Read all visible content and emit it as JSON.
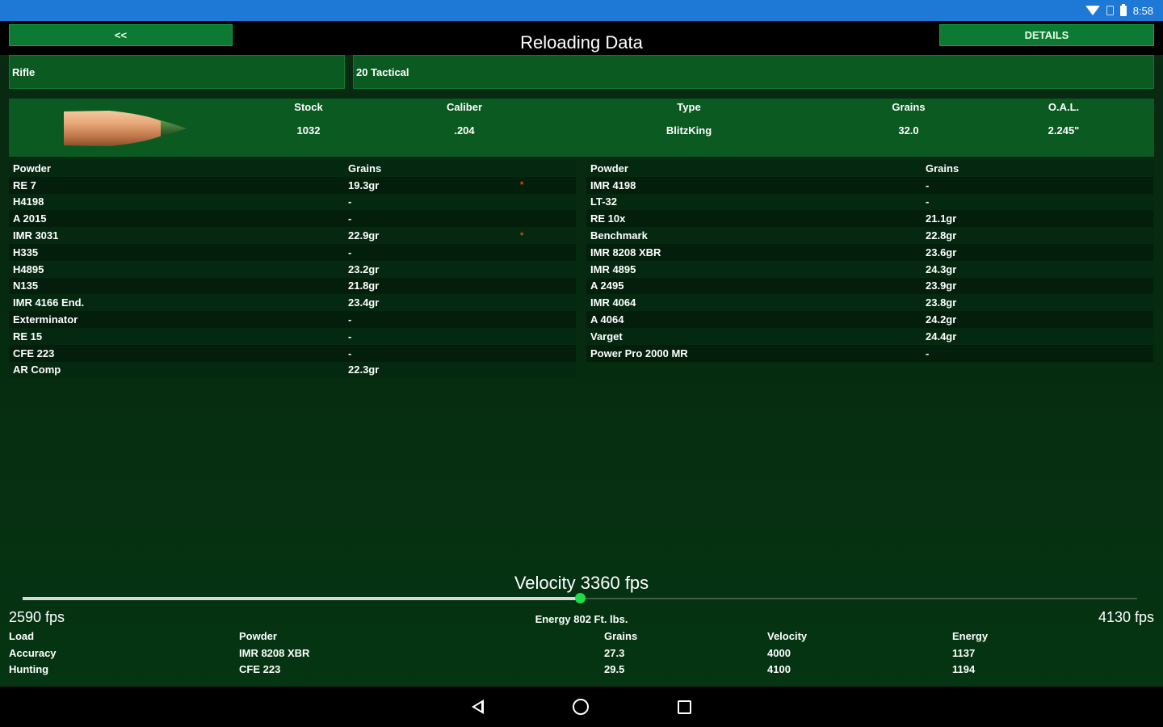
{
  "status_bar": {
    "time": "8:58",
    "icons": [
      "wifi-icon",
      "sim-icon",
      "battery-icon"
    ]
  },
  "header": {
    "back_label": "<<",
    "title": "Reloading Data",
    "details_label": "DETAILS"
  },
  "selectors": {
    "category": "Rifle",
    "caliber": "20 Tactical"
  },
  "bullet": {
    "image": "bullet-image",
    "specs": [
      {
        "label": "Stock",
        "value": "1032"
      },
      {
        "label": "Caliber",
        "value": ".204"
      },
      {
        "label": "Type",
        "value": "BlitzKing"
      },
      {
        "label": "Grains",
        "value": "32.0"
      },
      {
        "label": "O.A.L.",
        "value": "2.245\""
      }
    ]
  },
  "powder_table_left": {
    "headers": [
      "Powder",
      "Grains"
    ],
    "rows": [
      {
        "powder": "RE 7",
        "grains": "19.3gr",
        "star": "*"
      },
      {
        "powder": "H4198",
        "grains": "-"
      },
      {
        "powder": "A 2015",
        "grains": "-"
      },
      {
        "powder": "IMR 3031",
        "grains": "22.9gr",
        "star": "*"
      },
      {
        "powder": "H335",
        "grains": "-"
      },
      {
        "powder": "H4895",
        "grains": "23.2gr"
      },
      {
        "powder": "N135",
        "grains": "21.8gr"
      },
      {
        "powder": "IMR 4166 End.",
        "grains": "23.4gr"
      },
      {
        "powder": "Exterminator",
        "grains": "-"
      },
      {
        "powder": "RE 15",
        "grains": "-"
      },
      {
        "powder": "CFE 223",
        "grains": "-"
      },
      {
        "powder": "AR Comp",
        "grains": "22.3gr"
      }
    ]
  },
  "powder_table_right": {
    "headers": [
      "Powder",
      "Grains"
    ],
    "rows": [
      {
        "powder": "IMR 4198",
        "grains": "-"
      },
      {
        "powder": "LT-32",
        "grains": "-"
      },
      {
        "powder": "RE 10x",
        "grains": "21.1gr"
      },
      {
        "powder": "Benchmark",
        "grains": "22.8gr"
      },
      {
        "powder": "IMR 8208 XBR",
        "grains": "23.6gr"
      },
      {
        "powder": "IMR 4895",
        "grains": "24.3gr"
      },
      {
        "powder": "A 2495",
        "grains": "23.9gr"
      },
      {
        "powder": "IMR 4064",
        "grains": "23.8gr"
      },
      {
        "powder": "A 4064",
        "grains": "24.2gr"
      },
      {
        "powder": "Varget",
        "grains": "24.4gr"
      },
      {
        "powder": "Power Pro 2000 MR",
        "grains": "-"
      }
    ]
  },
  "velocity": {
    "title": "Velocity 3360 fps",
    "min_label": "2590 fps",
    "max_label": "4130 fps",
    "min": 2590,
    "max": 4130,
    "value": 3360,
    "energy_label": "Energy 802 Ft. lbs."
  },
  "loads": {
    "headers": [
      "Load",
      "Powder",
      "Grains",
      "Velocity",
      "Energy"
    ],
    "rows": [
      [
        "Accuracy",
        "IMR 8208 XBR",
        "27.3",
        "4000",
        "1137"
      ],
      [
        "Hunting",
        "CFE 223",
        "29.5",
        "4100",
        "1194"
      ]
    ]
  },
  "colors": {
    "status_bar": "#1e78d6",
    "button_green": "#0c7a32",
    "panel_green": "#0a5a22",
    "thumb": "#1fdc4a",
    "star": "#e04a10"
  }
}
